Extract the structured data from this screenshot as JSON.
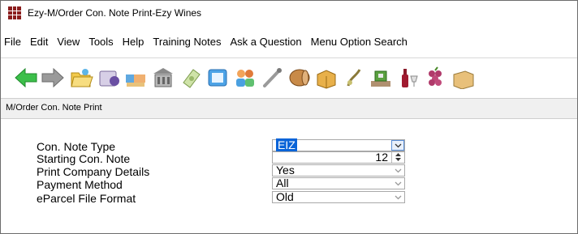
{
  "window": {
    "title": "Ezy-M/Order Con. Note Print-Ezy Wines"
  },
  "menu": {
    "items": [
      "File",
      "Edit",
      "View",
      "Tools",
      "Help",
      "Training Notes",
      "Ask a Question",
      "Menu Option Search"
    ]
  },
  "toolbar": {
    "icons": [
      "back-arrow-icon",
      "forward-arrow-icon",
      "folder-icon",
      "customers-icon",
      "handshake-icon",
      "building-icon",
      "banknote-icon",
      "screen-icon",
      "people-icon",
      "tools-icon",
      "barrel-icon",
      "package-icon",
      "vine-icon",
      "stock-icon",
      "wine-bottle-icon",
      "grapes-icon",
      "crate-icon"
    ]
  },
  "subheader": {
    "title": "M/Order Con. Note Print"
  },
  "form": {
    "con_note_type": {
      "label": "Con. Note Type",
      "value": "EIZ"
    },
    "starting_con_note": {
      "label": "Starting Con. Note",
      "value": "12"
    },
    "print_company_details": {
      "label": "Print Company Details",
      "value": "Yes"
    },
    "payment_method": {
      "label": "Payment Method",
      "value": "All"
    },
    "eparcel_file_format": {
      "label": "eParcel File Format",
      "value": "Old"
    }
  },
  "colors": {
    "selection": "#0a64d8",
    "field_border": "#a9a9a9",
    "subheader_bg": "#f0f0f0"
  }
}
